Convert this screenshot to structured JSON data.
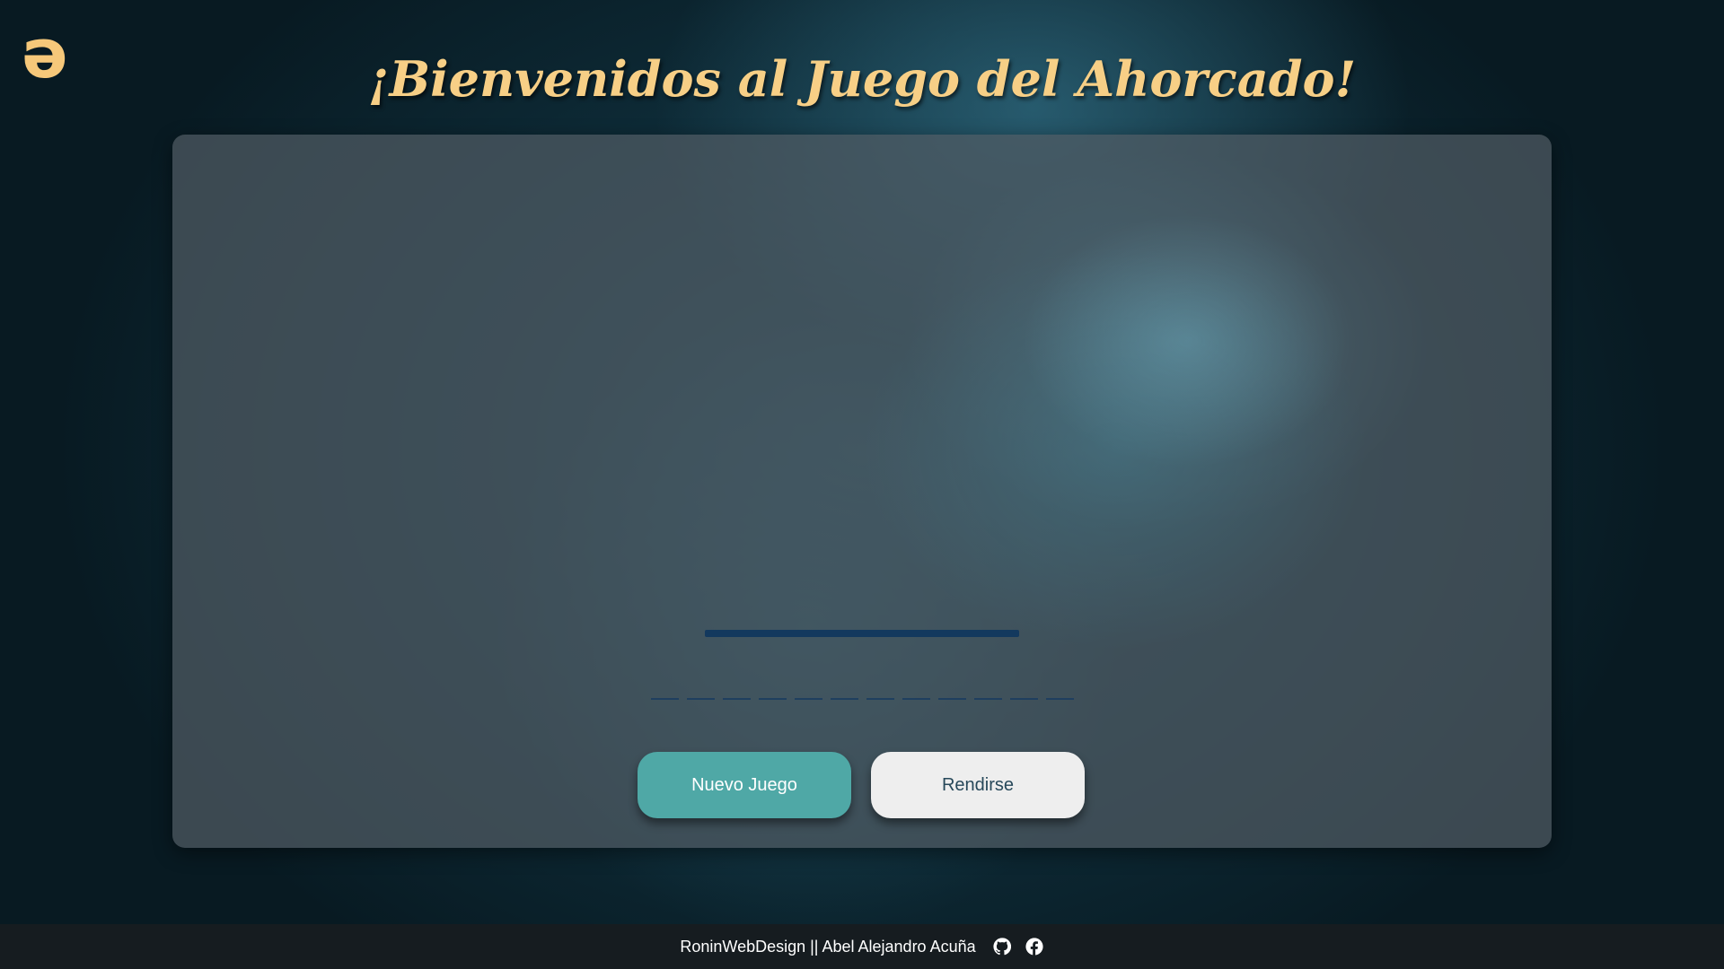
{
  "logo": {
    "glyph": "ə",
    "color": "#f6c87a"
  },
  "title": "¡Bienvenidos al Juego del Ahorcado!",
  "game": {
    "word_slots": [
      "",
      "",
      "",
      "",
      "",
      "",
      "",
      "",
      "",
      "",
      "",
      ""
    ],
    "buttons": {
      "new_game": "Nuevo Juego",
      "give_up": "Rendirse"
    }
  },
  "footer": {
    "credit": "RoninWebDesign || Abel Alejandro Acuña",
    "icons": [
      "github-icon",
      "facebook-icon"
    ]
  },
  "colors": {
    "title": "#f7cf86",
    "primary_button": "#4fa8a6",
    "secondary_button": "#eeeeee",
    "gallows": "#13395e",
    "footer_bg": "#161c20"
  }
}
